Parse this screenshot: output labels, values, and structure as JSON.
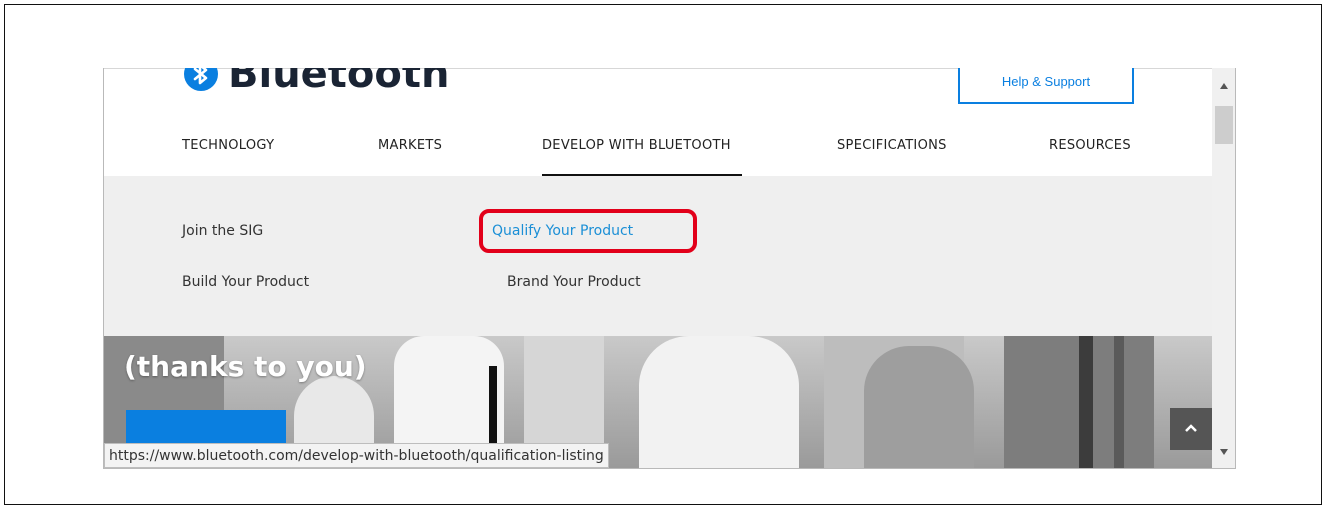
{
  "logo": {
    "text": "Bluetooth"
  },
  "header": {
    "help_label": "Help & Support"
  },
  "nav": {
    "items": [
      {
        "label": "TECHNOLOGY"
      },
      {
        "label": "MARKETS"
      },
      {
        "label": "DEVELOP WITH BLUETOOTH"
      },
      {
        "label": "SPECIFICATIONS"
      },
      {
        "label": "RESOURCES"
      }
    ],
    "active_item": "DEVELOP WITH BLUETOOTH"
  },
  "dropdown": {
    "links": [
      {
        "label": "Join the SIG"
      },
      {
        "label": "Qualify Your Product",
        "hovered": true
      },
      {
        "label": "Build Your Product"
      },
      {
        "label": "Brand Your Product"
      }
    ]
  },
  "hero": {
    "text": "(thanks to you)"
  },
  "status_bar": {
    "url": "https://www.bluetooth.com/develop-with-bluetooth/qualification-listing"
  },
  "colors": {
    "brand_blue": "#0a7fe0",
    "link_blue": "#1b8fd6",
    "highlight_red": "#e2001a",
    "dropdown_bg": "#efefef"
  },
  "icons": {
    "logo": "bluetooth-logo-icon",
    "scroll_top": "chevron-up-icon",
    "scroll_up": "scroll-up-arrow-icon",
    "scroll_down": "scroll-down-arrow-icon"
  }
}
